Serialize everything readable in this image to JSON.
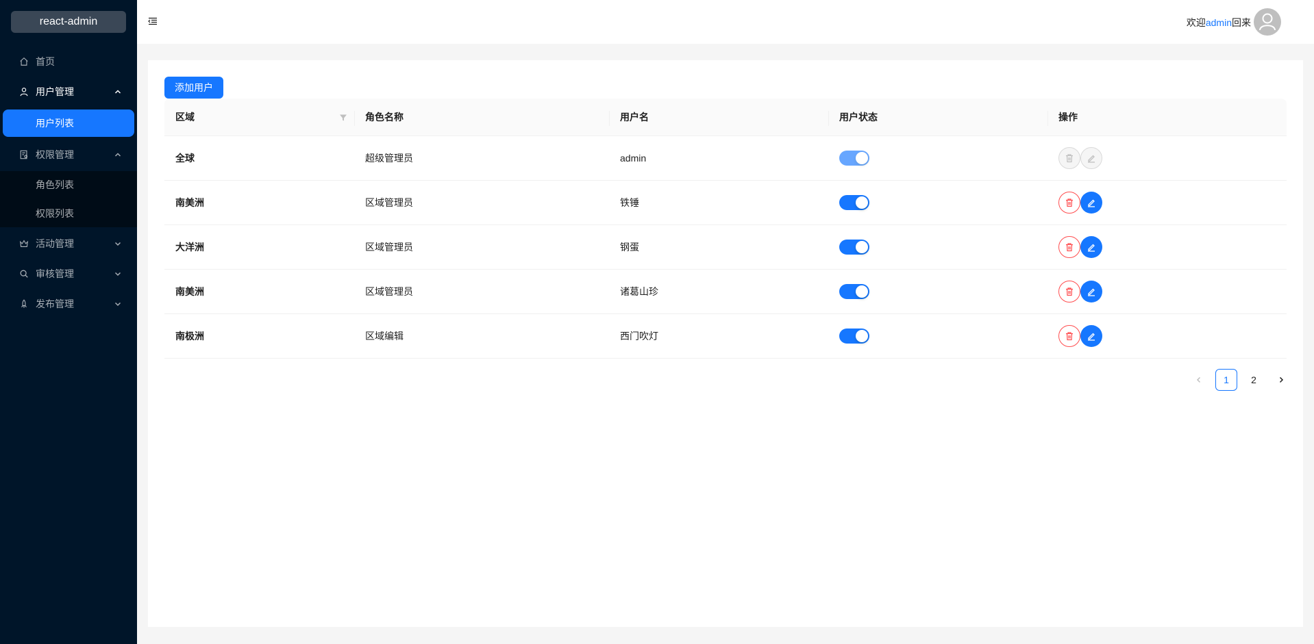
{
  "app": {
    "logo": "react-admin"
  },
  "sidebar": {
    "items": [
      {
        "label": "首页",
        "icon": "home-icon"
      },
      {
        "label": "用户管理",
        "icon": "user-icon",
        "expanded": true,
        "children": [
          {
            "label": "用户列表",
            "selected": true
          }
        ]
      },
      {
        "label": "权限管理",
        "icon": "audit-icon",
        "expanded": true,
        "children": [
          {
            "label": "角色列表"
          },
          {
            "label": "权限列表"
          }
        ]
      },
      {
        "label": "活动管理",
        "icon": "crown-icon",
        "expanded": false
      },
      {
        "label": "审核管理",
        "icon": "search-icon",
        "expanded": false
      },
      {
        "label": "发布管理",
        "icon": "rocket-icon",
        "expanded": false
      }
    ]
  },
  "header": {
    "welcome_prefix": "欢迎",
    "username": "admin",
    "welcome_suffix": "回来"
  },
  "toolbar": {
    "add_label": "添加用户"
  },
  "table": {
    "columns": [
      "区域",
      "角色名称",
      "用户名",
      "用户状态",
      "操作"
    ],
    "rows": [
      {
        "region": "全球",
        "role": "超级管理员",
        "username": "admin",
        "status": true,
        "locked": true
      },
      {
        "region": "南美洲",
        "role": "区域管理员",
        "username": "铁锤",
        "status": true,
        "locked": false
      },
      {
        "region": "大洋洲",
        "role": "区域管理员",
        "username": "钢蛋",
        "status": true,
        "locked": false
      },
      {
        "region": "南美洲",
        "role": "区域管理员",
        "username": "诸葛山珍",
        "status": true,
        "locked": false
      },
      {
        "region": "南极洲",
        "role": "区域编辑",
        "username": "西门吹灯",
        "status": true,
        "locked": false
      }
    ]
  },
  "pagination": {
    "pages": [
      "1",
      "2"
    ],
    "current": "1"
  },
  "colors": {
    "primary": "#1677ff",
    "danger": "#ff4d4f",
    "sider": "#001529"
  }
}
